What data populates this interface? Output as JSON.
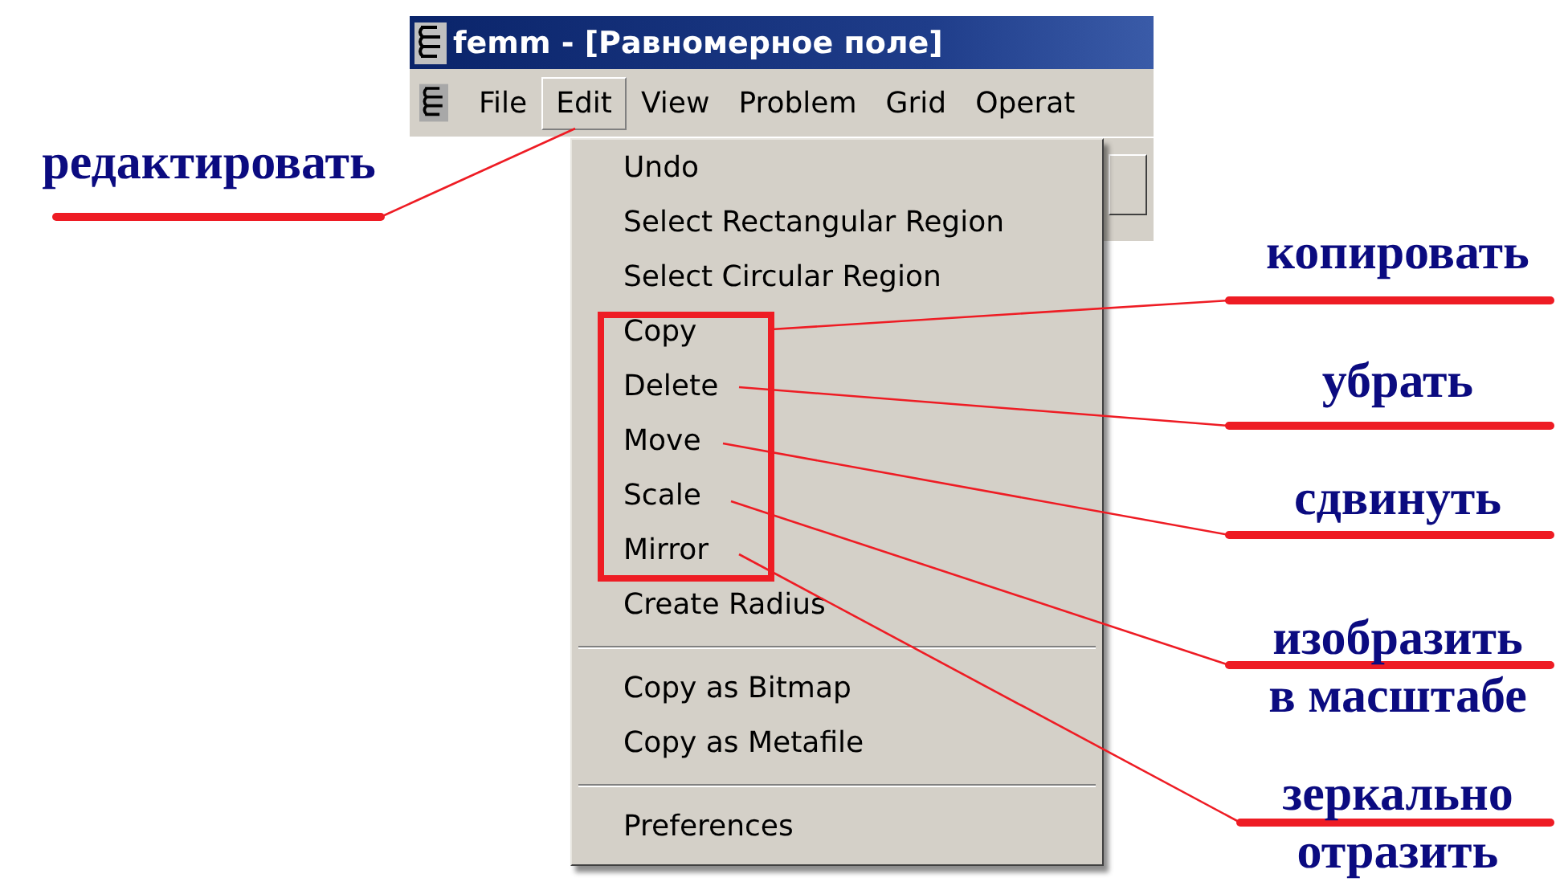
{
  "window": {
    "title": "femm - [Равномерное поле]"
  },
  "menu_bar": [
    {
      "label": "File",
      "selected": false
    },
    {
      "label": "Edit",
      "selected": true
    },
    {
      "label": "View",
      "selected": false
    },
    {
      "label": "Problem",
      "selected": false
    },
    {
      "label": "Grid",
      "selected": false
    },
    {
      "label": "Operat",
      "selected": false
    }
  ],
  "edit_menu": [
    {
      "kind": "item",
      "label": "Undo"
    },
    {
      "kind": "item",
      "label": "Select Rectangular Region"
    },
    {
      "kind": "item",
      "label": "Select Circular Region"
    },
    {
      "kind": "item",
      "label": "Copy"
    },
    {
      "kind": "item",
      "label": "Delete"
    },
    {
      "kind": "item",
      "label": "Move"
    },
    {
      "kind": "item",
      "label": "Scale"
    },
    {
      "kind": "item",
      "label": "Mirror"
    },
    {
      "kind": "item",
      "label": "Create Radius"
    },
    {
      "kind": "separator"
    },
    {
      "kind": "item",
      "label": "Copy as Bitmap"
    },
    {
      "kind": "item",
      "label": "Copy as Metafile"
    },
    {
      "kind": "separator"
    },
    {
      "kind": "item",
      "label": "Preferences"
    }
  ],
  "annotations": [
    {
      "lines": [
        "редактировать"
      ]
    },
    {
      "lines": [
        "копировать"
      ]
    },
    {
      "lines": [
        "убрать"
      ]
    },
    {
      "lines": [
        "сдвинуть"
      ]
    },
    {
      "lines": [
        "изобразить",
        "в масштабе"
      ]
    },
    {
      "lines": [
        "зеркально",
        "отразить"
      ]
    }
  ]
}
